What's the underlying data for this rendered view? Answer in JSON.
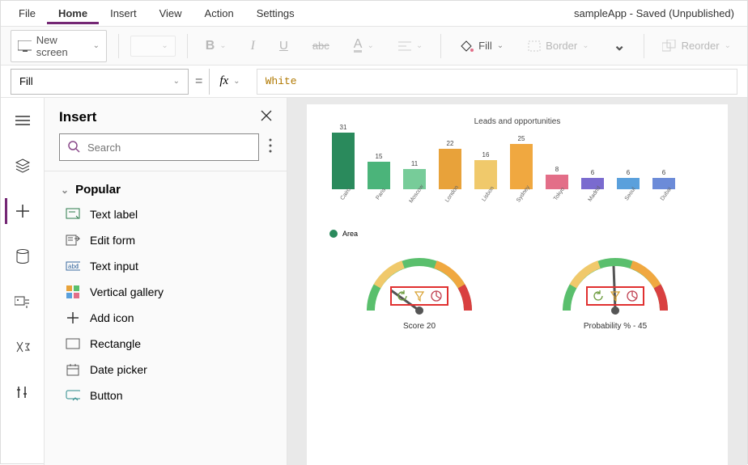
{
  "menubar": {
    "items": [
      "File",
      "Home",
      "Insert",
      "View",
      "Action",
      "Settings"
    ],
    "active_index": 1
  },
  "app_title": "sampleApp - Saved (Unpublished)",
  "ribbon": {
    "new_screen": "New screen",
    "fill": "Fill",
    "border": "Border",
    "reorder": "Reorder"
  },
  "formula": {
    "property": "Fill",
    "equals": "=",
    "fx": "fx",
    "value": "White"
  },
  "panel": {
    "title": "Insert",
    "search_placeholder": "Search",
    "group": "Popular",
    "items": [
      {
        "label": "Text label",
        "icon": "textlabel"
      },
      {
        "label": "Edit form",
        "icon": "editform"
      },
      {
        "label": "Text input",
        "icon": "textinput"
      },
      {
        "label": "Vertical gallery",
        "icon": "vgallery"
      },
      {
        "label": "Add icon",
        "icon": "addicon"
      },
      {
        "label": "Rectangle",
        "icon": "rect"
      },
      {
        "label": "Date picker",
        "icon": "datepicker"
      },
      {
        "label": "Button",
        "icon": "button"
      }
    ]
  },
  "canvas": {
    "chart_title": "Leads and opportunities",
    "legend": "Area",
    "gauge1_label": "Score   20",
    "gauge2_label": "Probability % -  45"
  },
  "chart_data": {
    "type": "bar",
    "title": "Leads and opportunities",
    "categories": [
      "Cairo",
      "Paris",
      "Moscow",
      "London",
      "Lisbon",
      "Sydney",
      "Tokyo",
      "Madrid",
      "Seoul",
      "Dubai"
    ],
    "values": [
      31,
      15,
      11,
      22,
      16,
      25,
      8,
      6,
      6,
      6
    ],
    "colors": [
      "#2a8a5c",
      "#4bb47a",
      "#77cc99",
      "#e8a23a",
      "#f0c96b",
      "#f0a840",
      "#e36e88",
      "#7a6bcf",
      "#5aa0dc",
      "#6c8bd8"
    ],
    "ylim": [
      0,
      31
    ]
  },
  "gauges": [
    {
      "label": "Score",
      "value": 20,
      "min": 0,
      "max": 100,
      "needle_angle_deg": 25
    },
    {
      "label": "Probability %",
      "value": 45,
      "min": 0,
      "max": 100,
      "needle_angle_deg": 80
    }
  ]
}
